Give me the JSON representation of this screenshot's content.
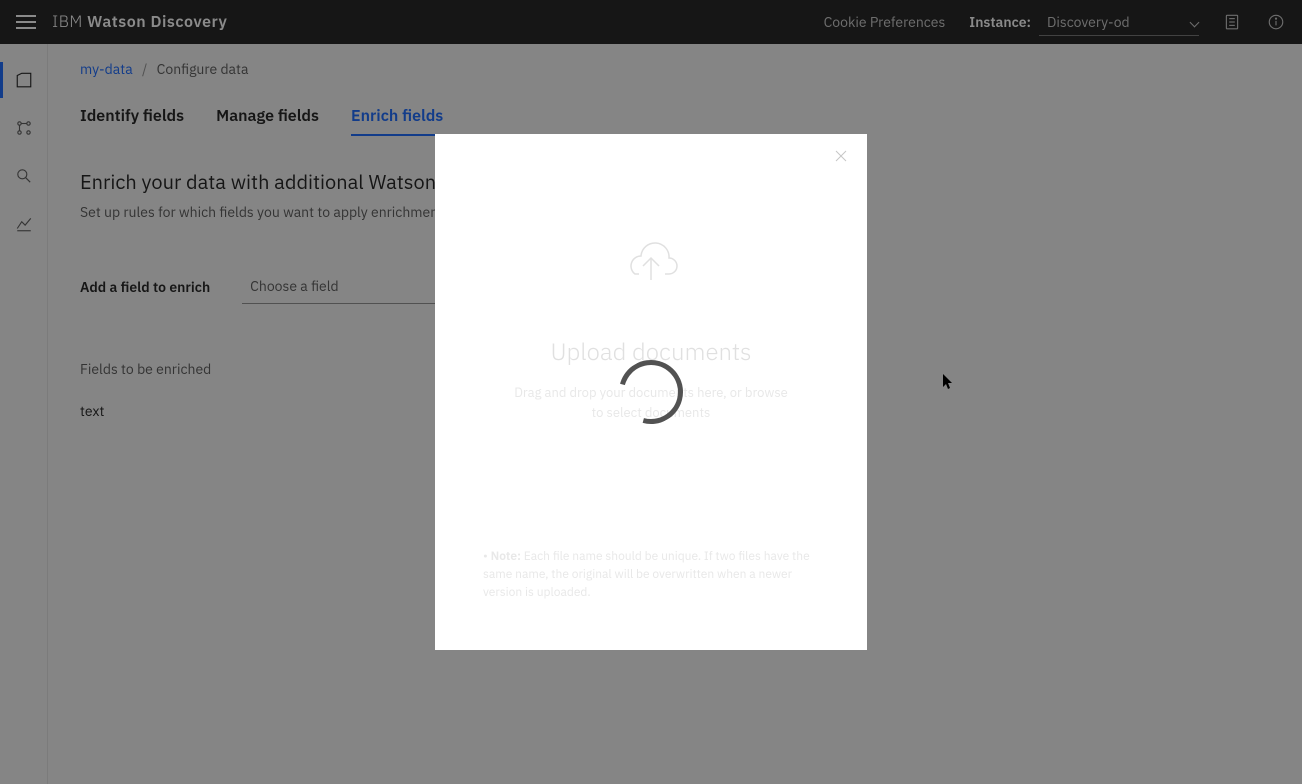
{
  "header": {
    "brand_light": "IBM ",
    "brand_bold": "Watson Discovery",
    "cookie_prefs": "Cookie Preferences",
    "instance_label": "Instance:",
    "instance_value": "Discovery-od"
  },
  "breadcrumb": {
    "link": "my-data",
    "current": "Configure data"
  },
  "tabs": [
    {
      "label": "Identify fields",
      "active": false
    },
    {
      "label": "Manage fields",
      "active": false
    },
    {
      "label": "Enrich fields",
      "active": true
    }
  ],
  "enrich": {
    "title": "Enrich your data with additional Watson insights",
    "subtitle": "Set up rules for which fields you want to apply enrichments to.",
    "field_label": "Add a field to enrich",
    "field_placeholder": "Choose a field",
    "list_title": "Fields to be enriched",
    "fields": [
      "text"
    ]
  },
  "modal": {
    "title": "Upload documents",
    "subtitle": "Drag and drop your documents here, or browse to select documents",
    "note_label": "Note: ",
    "note_text": "Each file name should be unique. If two files have the same name, the original will be overwritten when a newer version is uploaded."
  }
}
